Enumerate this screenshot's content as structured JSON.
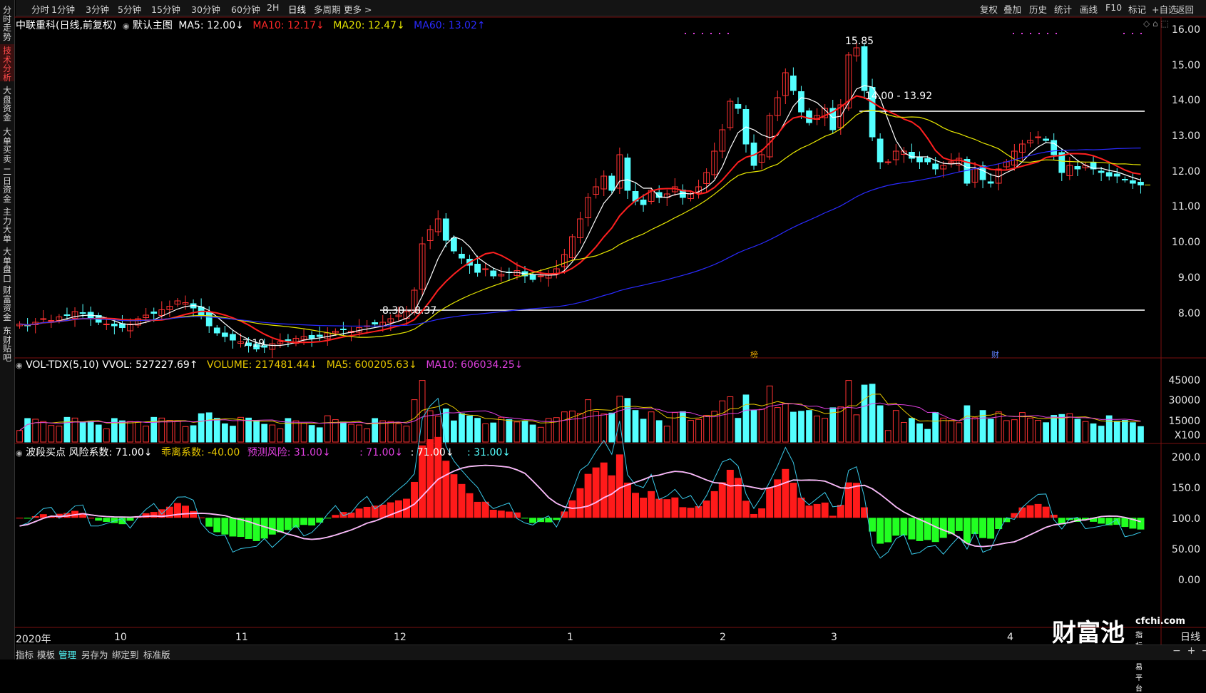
{
  "sidebar": [
    {
      "label": "分时走势"
    },
    {
      "label": "技术分析"
    },
    {
      "label": "大盘资金"
    },
    {
      "label": "大单买卖"
    },
    {
      "label": "二日资金"
    },
    {
      "label": "主力大单"
    },
    {
      "label": "大单盘口"
    },
    {
      "label": "财富资金"
    },
    {
      "label": "东财贴吧"
    }
  ],
  "topbar": {
    "periods": [
      "分时",
      "1分钟",
      "3分钟",
      "5分钟",
      "15分钟",
      "30分钟",
      "60分钟",
      "2H",
      "日线",
      "多周期",
      "更多 >"
    ],
    "active_period": "日线",
    "right_tools": [
      "复权",
      "叠加",
      "历史",
      "统计",
      "画线",
      "F10",
      "标记",
      "+自选",
      "返回"
    ]
  },
  "main_legend": {
    "title": "中联重科(日线,前复权)",
    "main_label": "默认主图",
    "ma5": "MA5: 12.00↓",
    "ma10": "MA10: 12.17↓",
    "ma20": "MA20: 12.47↓",
    "ma60": "MA60: 13.02↑"
  },
  "vol_legend": {
    "name": "VOL-TDX(5,10) VVOL: 527227.69↑",
    "volume": "VOLUME: 217481.44↓",
    "ma5": "MA5: 600205.63↓",
    "ma10": "MA10: 606034.25↓"
  },
  "ind_legend": {
    "name": "波段买点 风险系数: 71.00↓",
    "deviate": "乖离系数: -40.00",
    "risk": "预测风险: 31.00↓",
    "v1": ": 71.00↓",
    "v2": ": 71.00↓",
    "v3": ": 31.00↓"
  },
  "annotations": {
    "high": "15.85",
    "low": "7.19",
    "range_upper": "14.00 - 13.92",
    "range_lower": "8.30 - 8.37",
    "mark_bang": "榜",
    "mark_cai": "财"
  },
  "price_axis": [
    "16.00",
    "15.00",
    "14.00",
    "13.00",
    "12.00",
    "11.00",
    "10.00",
    "9.00",
    "8.00"
  ],
  "vol_axis": [
    "45000",
    "30000",
    "15000",
    "X100"
  ],
  "ind_axis": [
    "200.0",
    "150.0",
    "100.0",
    "50.00",
    "0.00"
  ],
  "x_axis": [
    "2020年",
    "10",
    "11",
    "12",
    "1",
    "2",
    "3",
    "4",
    "日线"
  ],
  "bottombar": [
    "指标",
    "模板",
    "管理",
    "另存为",
    "绑定到",
    "标准版"
  ],
  "logo": {
    "big": "财富池",
    "domain": "cfchi.com",
    "sub": "指标交易平台"
  },
  "colors": {
    "up": "#ff3232",
    "down": "#54ffff",
    "ma5": "#ffffff",
    "ma10": "#ff2020",
    "ma20": "#e6e600",
    "ma60": "#2a2aff",
    "vol_ma10": "#e040e0",
    "risk_line": "#ff66ff",
    "deviate": "#e6e600"
  },
  "chart_data": {
    "type": "candlestick",
    "symbol": "中联重科",
    "ylim": [
      7.0,
      16.2
    ],
    "high_mark": 15.85,
    "low_mark": 7.19,
    "hlines": [
      13.92,
      8.34
    ],
    "closes": [
      7.95,
      7.9,
      8.0,
      8.1,
      8.05,
      8.15,
      8.2,
      8.3,
      8.25,
      8.1,
      8.0,
      7.95,
      7.9,
      7.85,
      7.95,
      8.1,
      8.2,
      8.25,
      8.35,
      8.45,
      8.6,
      8.55,
      8.4,
      8.2,
      7.9,
      7.7,
      7.6,
      7.5,
      7.45,
      7.35,
      7.25,
      7.3,
      7.4,
      7.45,
      7.5,
      7.55,
      7.6,
      7.55,
      7.6,
      7.7,
      7.75,
      7.8,
      7.75,
      7.85,
      7.9,
      7.95,
      8.0,
      8.1,
      8.2,
      8.3,
      8.9,
      10.2,
      10.6,
      10.9,
      10.3,
      10.0,
      9.8,
      9.6,
      9.4,
      9.5,
      9.3,
      9.35,
      9.4,
      9.45,
      9.3,
      9.2,
      9.3,
      9.35,
      9.5,
      9.9,
      10.4,
      10.9,
      11.5,
      11.8,
      12.1,
      11.7,
      12.7,
      11.7,
      11.4,
      11.3,
      11.7,
      11.5,
      11.6,
      11.8,
      11.5,
      11.6,
      11.8,
      12.2,
      12.8,
      13.4,
      14.2,
      14.0,
      13.0,
      12.4,
      12.7,
      13.8,
      14.3,
      15.0,
      14.5,
      13.9,
      13.6,
      13.8,
      14.0,
      13.4,
      14.1,
      15.5,
      15.7,
      14.5,
      13.2,
      12.5,
      12.5,
      12.8,
      12.8,
      12.6,
      12.5,
      12.5,
      12.3,
      12.4,
      12.5,
      12.6,
      11.9,
      12.3,
      12.0,
      11.9,
      12.3,
      12.5,
      12.8,
      13.0,
      13.1,
      13.2,
      13.1,
      12.7,
      12.2,
      12.4,
      12.3,
      12.4,
      12.3,
      12.2,
      12.1,
      12.1,
      12.0,
      11.9,
      11.85
    ],
    "volume_unit": "X100",
    "volume_ylim": [
      0,
      50000
    ],
    "indicator_ylim": [
      -100,
      220
    ]
  }
}
